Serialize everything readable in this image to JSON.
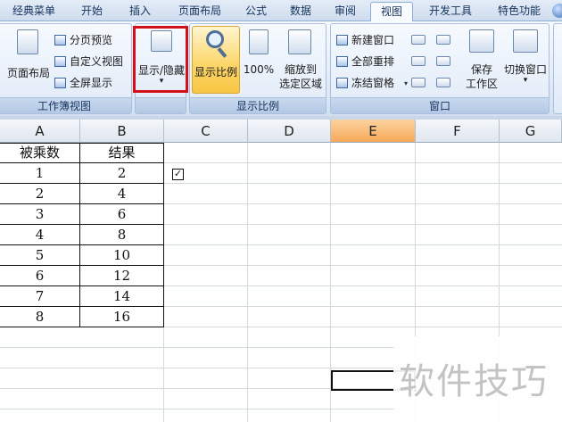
{
  "tabs": [
    {
      "label": "经典菜单"
    },
    {
      "label": "开始"
    },
    {
      "label": "插入"
    },
    {
      "label": "页面布局"
    },
    {
      "label": "公式"
    },
    {
      "label": "数据"
    },
    {
      "label": "审阅"
    },
    {
      "label": "视图"
    },
    {
      "label": "开发工具"
    },
    {
      "label": "特色功能"
    }
  ],
  "active_tab": "视图",
  "ribbon": {
    "workbook_views": {
      "caption": "工作簿视图",
      "page_layout": "页面布局",
      "page_break_preview": "分页预览",
      "custom_views": "自定义视图",
      "full_screen": "全屏显示"
    },
    "show_hide": {
      "label": "显示/隐藏",
      "dropdown_glyph": "▾"
    },
    "zoom": {
      "caption": "显示比例",
      "zoom_label": "显示比例",
      "hundred_label": "100%",
      "zoom_to_selection_line1": "缩放到",
      "zoom_to_selection_line2": "选定区域"
    },
    "window": {
      "caption": "窗口",
      "new_window": "新建窗口",
      "arrange_all": "全部重排",
      "freeze_panes": "冻结窗格",
      "save_workspace_line1": "保存",
      "save_workspace_line2": "工作区",
      "switch_windows": "切换窗口"
    }
  },
  "columns": [
    "A",
    "B",
    "C",
    "D",
    "E",
    "F",
    "G"
  ],
  "selected_column": "E",
  "table": {
    "headers": [
      "被乘数",
      "结果"
    ],
    "rows": [
      [
        "1",
        "2"
      ],
      [
        "2",
        "4"
      ],
      [
        "3",
        "6"
      ],
      [
        "4",
        "8"
      ],
      [
        "5",
        "10"
      ],
      [
        "6",
        "12"
      ],
      [
        "7",
        "14"
      ],
      [
        "8",
        "16"
      ]
    ]
  },
  "checkbox_glyph": "✓",
  "watermark": "软件技巧",
  "colors": {
    "highlight_box": "#d4101a",
    "selected_column_header": "#f7a858",
    "ribbon_background": "#dfe9f6"
  }
}
